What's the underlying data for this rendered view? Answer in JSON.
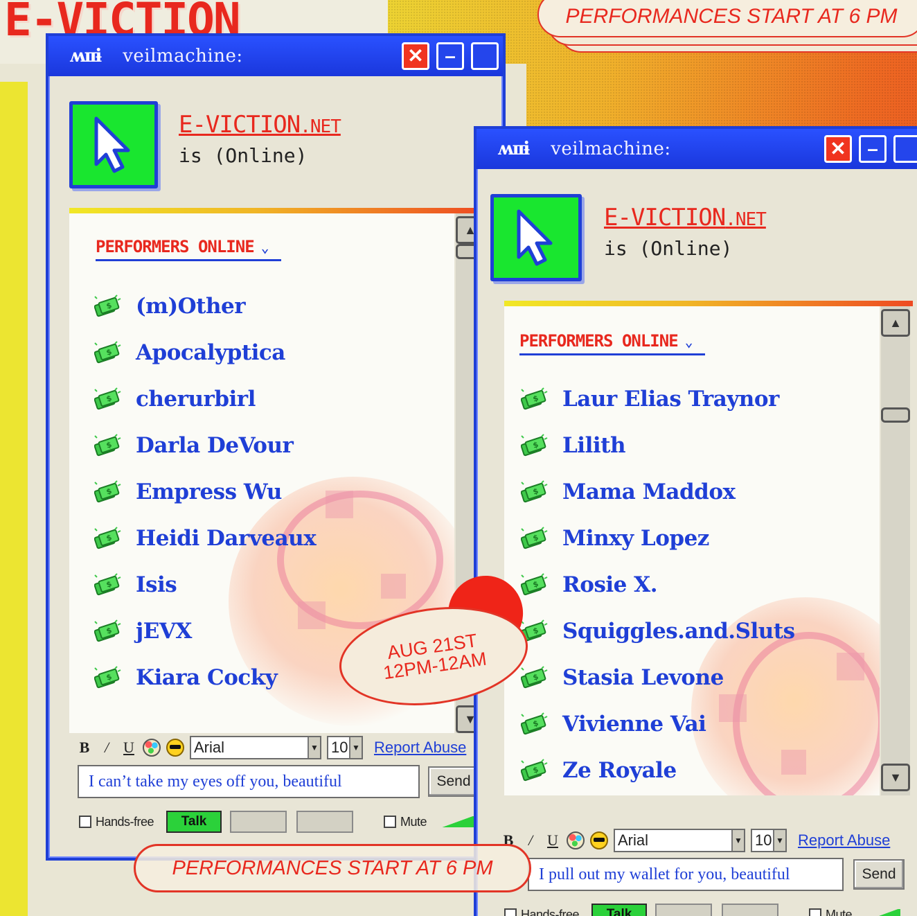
{
  "background": {
    "title": "E-VICTION",
    "banner_top": "PERFORMANCES START AT 6 PM",
    "banner_bottom": "PERFORMANCES START AT 6 PM"
  },
  "date_badge": {
    "line1": "AUG 21ST",
    "line2": "12PM-12AM"
  },
  "colors": {
    "accent_red": "#e8281e",
    "brand_blue": "#1f3fd6",
    "avatar_green": "#19e62f",
    "talk_green": "#2bd13a"
  },
  "window_left": {
    "titlebar": {
      "logo": "ʍɪɪɨ",
      "name": "veilmachine:",
      "close": "✕",
      "min": "–",
      "max": ""
    },
    "site": {
      "name": "E-VICTION",
      "tld": ".NET",
      "status": "is (Online)"
    },
    "section_title": "PERFORMERS ONLINE",
    "chevron": "⌄",
    "performers": [
      "(m)Other",
      "Apocalyptica",
      "cherurbirl",
      "Darla DeVour",
      "Empress Wu",
      "Heidi Darveaux",
      "Isis",
      "jEVX",
      "Kiara Cocky"
    ],
    "toolbar": {
      "bold": "B",
      "italic": "/",
      "underline": "U",
      "font": "Arial",
      "size": "10",
      "report": "Report Abuse"
    },
    "message": "I can’t take my eyes off you, beautiful",
    "send": "Send",
    "voice": {
      "hands_free": "Hands-free",
      "talk": "Talk",
      "mute": "Mute"
    }
  },
  "window_right": {
    "titlebar": {
      "logo": "ʍɪɪɨ",
      "name": "veilmachine:",
      "close": "✕",
      "min": "–",
      "max": ""
    },
    "site": {
      "name": "E-VICTION",
      "tld": ".NET",
      "status": "is (Online)"
    },
    "section_title": "PERFORMERS ONLINE",
    "chevron": "⌄",
    "performers": [
      "Laur Elias Traynor",
      "Lilith",
      "Mama Maddox",
      "Minxy Lopez",
      "Rosie X.",
      "Squiggles.and.Sluts",
      "Stasia Levone",
      "Vivienne Vai",
      "Ze Royale"
    ],
    "toolbar": {
      "bold": "B",
      "italic": "/",
      "underline": "U",
      "font": "Arial",
      "size": "10",
      "report": "Report Abuse"
    },
    "message": "I pull out my wallet for you, beautiful",
    "send": "Send",
    "voice": {
      "hands_free": "Hands-free",
      "talk": "Talk",
      "mute": "Mute"
    }
  },
  "icons": {
    "performer": "money-icon",
    "avatar": "cursor-icon",
    "emoticon_a": "palette-icon",
    "emoticon_b": "sunglasses-icon"
  }
}
